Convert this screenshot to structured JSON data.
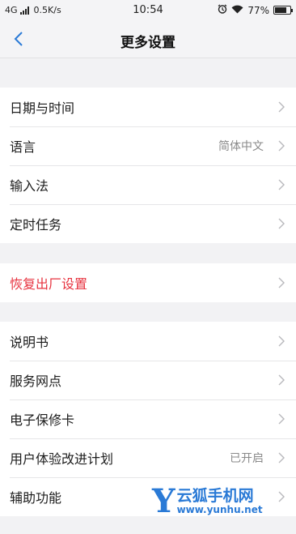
{
  "status_bar": {
    "network": "4G",
    "speed": "0.5K/s",
    "time": "10:54",
    "battery": "77%",
    "battery_level": 0.77
  },
  "header": {
    "title": "更多设置"
  },
  "groups": [
    {
      "items": [
        {
          "label": "日期与时间",
          "value": ""
        },
        {
          "label": "语言",
          "value": "简体中文"
        },
        {
          "label": "输入法",
          "value": ""
        },
        {
          "label": "定时任务",
          "value": ""
        }
      ]
    },
    {
      "items": [
        {
          "label": "恢复出厂设置",
          "value": ""
        }
      ]
    },
    {
      "items": [
        {
          "label": "说明书",
          "value": ""
        },
        {
          "label": "服务网点",
          "value": ""
        },
        {
          "label": "电子保修卡",
          "value": ""
        },
        {
          "label": "用户体验改进计划",
          "value": "已开启"
        },
        {
          "label": "辅助功能",
          "value": ""
        }
      ]
    }
  ],
  "watermark": {
    "letter": "Y",
    "name": "云狐手机网",
    "url": "www.yunhu.net"
  },
  "colors": {
    "danger": "#e7333f",
    "accent": "#2a7ad6"
  }
}
